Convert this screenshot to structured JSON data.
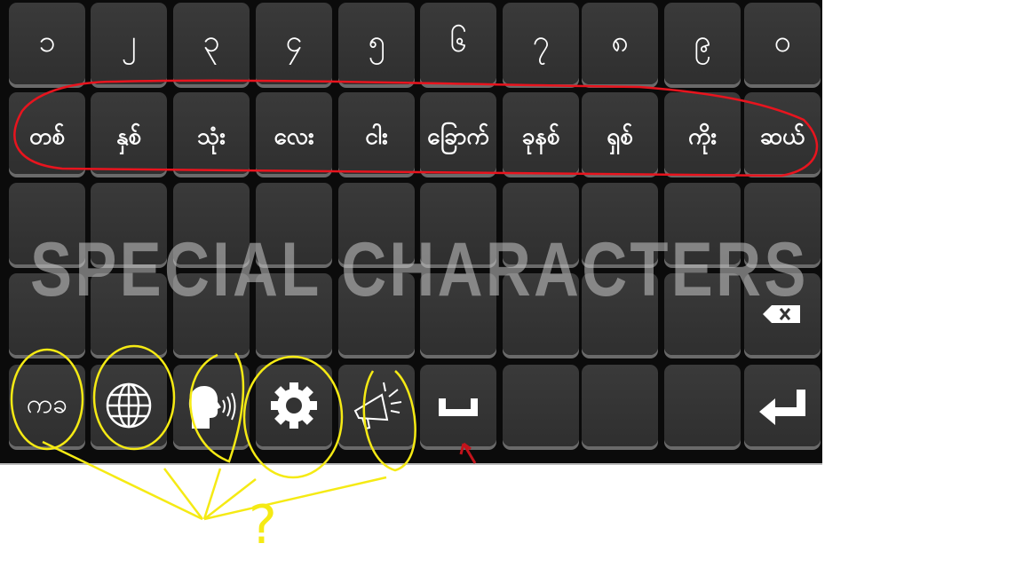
{
  "keyboard": {
    "digit_row": [
      "၁",
      "၂",
      "၃",
      "၄",
      "၅",
      "၆",
      "၇",
      "၈",
      "၉",
      "၀"
    ],
    "word_row": [
      "တစ်",
      "နှစ်",
      "သုံး",
      "လေး",
      "ငါး",
      "ခြောက်",
      "ခုနစ်",
      "ရှစ်",
      "ကိုး",
      "ဆယ်"
    ],
    "watermark": "SPECIAL  CHARACTERS",
    "lang_key_label": "ကခ",
    "icons": {
      "backspace": "backspace-icon",
      "lang": "myanmar-script-icon",
      "globe": "globe-icon",
      "voice": "speaking-head-icon",
      "settings": "gear-icon",
      "announce": "megaphone-icon",
      "space": "space-bar-icon",
      "enter": "enter-icon"
    }
  },
  "annotations": {
    "question_mark": "?",
    "highlight_color": "#e8141e",
    "marker_color": "#f5ea14"
  }
}
